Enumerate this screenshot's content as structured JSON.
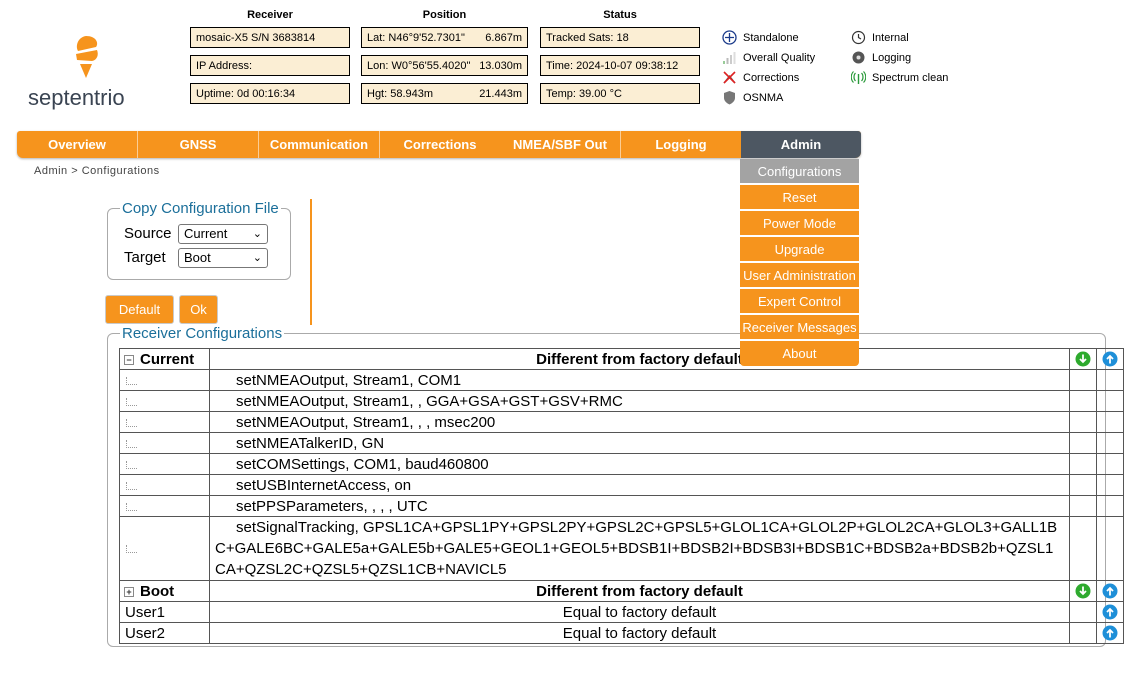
{
  "brand": {
    "name": "septentrio"
  },
  "header": {
    "receiver_title": "Receiver",
    "position_title": "Position",
    "status_title": "Status",
    "receiver": [
      "mosaic-X5 S/N 3683814",
      "IP Address:",
      "Uptime: 0d 00:16:34"
    ],
    "position": [
      {
        "value": "Lat:  N46°9'52.7301\"",
        "acc": "6.867m"
      },
      {
        "value": "Lon: W0°56'55.4020\"",
        "acc": "13.030m"
      },
      {
        "value": "Hgt:  58.943m",
        "acc": "21.443m"
      }
    ],
    "status": [
      "Tracked Sats: 18",
      "Time: 2024-10-07 09:38:12",
      "Temp: 39.00 °C"
    ],
    "indicators_left": [
      "Standalone",
      "Overall Quality",
      "Corrections",
      "OSNMA"
    ],
    "indicators_right": [
      "Internal",
      "Logging",
      "Spectrum clean"
    ]
  },
  "nav": [
    "Overview",
    "GNSS",
    "Communication",
    "Corrections",
    "NMEA/SBF Out",
    "Logging",
    "Admin"
  ],
  "admin_menu": [
    "Configurations",
    "Reset",
    "Power Mode",
    "Upgrade",
    "User Administration",
    "Expert Control",
    "Receiver Messages",
    "About"
  ],
  "breadcrumb": "Admin > Configurations",
  "copy_config": {
    "legend": "Copy Configuration File",
    "source_label": "Source",
    "source_value": "Current",
    "target_label": "Target",
    "target_value": "Boot"
  },
  "buttons": {
    "default": "Default",
    "ok": "Ok"
  },
  "receiver_configs": {
    "legend": "Receiver Configurations",
    "current": {
      "name": "Current",
      "status": "Different from factory default"
    },
    "commands": [
      "setNMEAOutput, Stream1, COM1",
      "setNMEAOutput, Stream1, , GGA+GSA+GST+GSV+RMC",
      "setNMEAOutput, Stream1, , , msec200",
      "setNMEATalkerID, GN",
      "setCOMSettings, COM1, baud460800",
      "setUSBInternetAccess, on",
      "setPPSParameters, , , , UTC",
      "setSignalTracking, GPSL1CA+GPSL1PY+GPSL2PY+GPSL2C+GPSL5+GLOL1CA+GLOL2P+GLOL2CA+GLOL3+GALL1BC+GALE6BC+GALE5a+GALE5b+GALE5+GEOL1+GEOL5+BDSB1I+BDSB2I+BDSB3I+BDSB1C+BDSB2a+BDSB2b+QZSL1CA+QZSL2C+QZSL5+QZSL1CB+NAVICL5"
    ],
    "boot": {
      "name": "Boot",
      "status": "Different from factory default"
    },
    "user1": {
      "name": "User1",
      "status": "Equal to factory default"
    },
    "user2": {
      "name": "User2",
      "status": "Equal to factory default"
    }
  }
}
